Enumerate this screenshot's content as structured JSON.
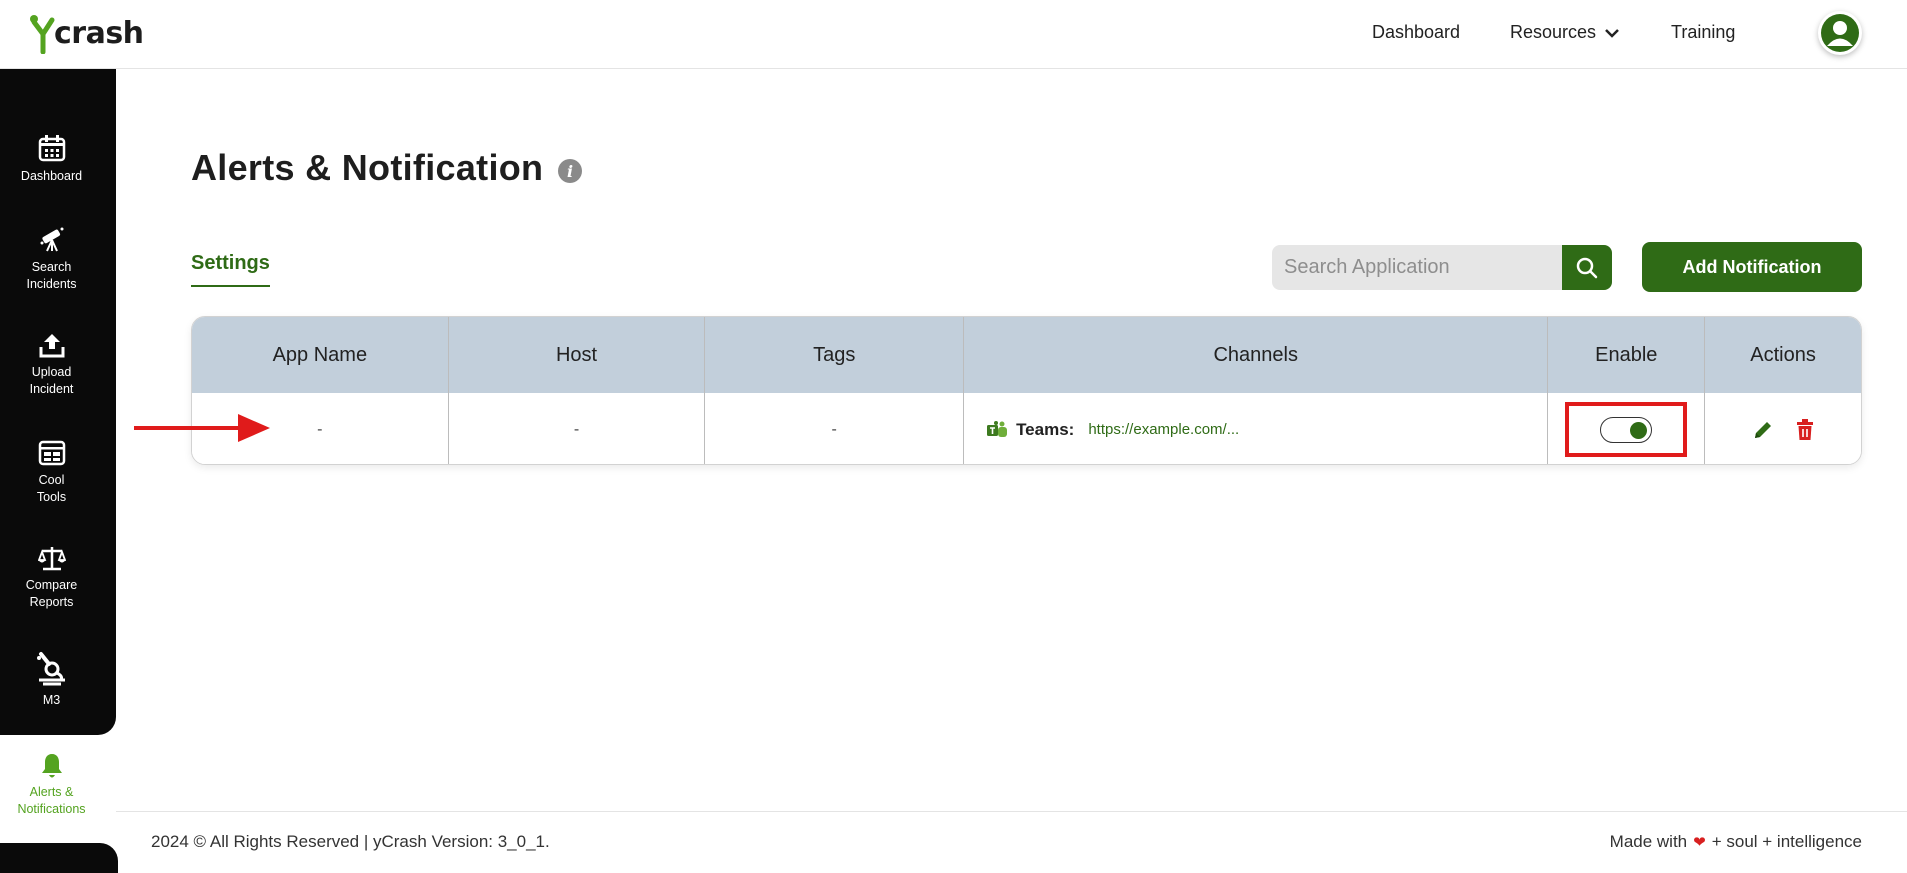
{
  "brand": {
    "logo_text": "crash"
  },
  "topnav": {
    "dashboard": "Dashboard",
    "resources": "Resources",
    "training": "Training"
  },
  "sidebar": {
    "items": [
      {
        "label": "Dashboard",
        "icon": "calendar-icon"
      },
      {
        "label": "Search Incidents",
        "icon": "telescope-icon"
      },
      {
        "label": "Upload Incident",
        "icon": "upload-icon"
      },
      {
        "label": "Cool Tools",
        "icon": "tools-grid-icon"
      },
      {
        "label": "Compare Reports",
        "icon": "scale-icon"
      },
      {
        "label": "M3",
        "icon": "microscope-icon"
      }
    ],
    "active": {
      "label": "Alerts & Notifications",
      "icon": "bell-icon"
    }
  },
  "main": {
    "title": "Alerts & Notification",
    "tab": "Settings",
    "search": {
      "placeholder": "Search Application"
    },
    "add_button": "Add Notification"
  },
  "table": {
    "headers": [
      "App Name",
      "Host",
      "Tags",
      "Channels",
      "Enable",
      "Actions"
    ],
    "rows": [
      {
        "app_name": "-",
        "host": "-",
        "tags": "-",
        "channel_name": "Teams:",
        "channel_url": "https://example.com/...",
        "enabled": true
      }
    ]
  },
  "footer": {
    "left": "2024 © All Rights Reserved | yCrash Version: 3_0_1.",
    "made_with": "Made with",
    "right_tail": "+ soul + intelligence"
  },
  "colors": {
    "brand_green": "#2f6b16",
    "accent_green": "#54a320",
    "annotation_red": "#e01b1b",
    "header_row": "#c2cfdb"
  }
}
